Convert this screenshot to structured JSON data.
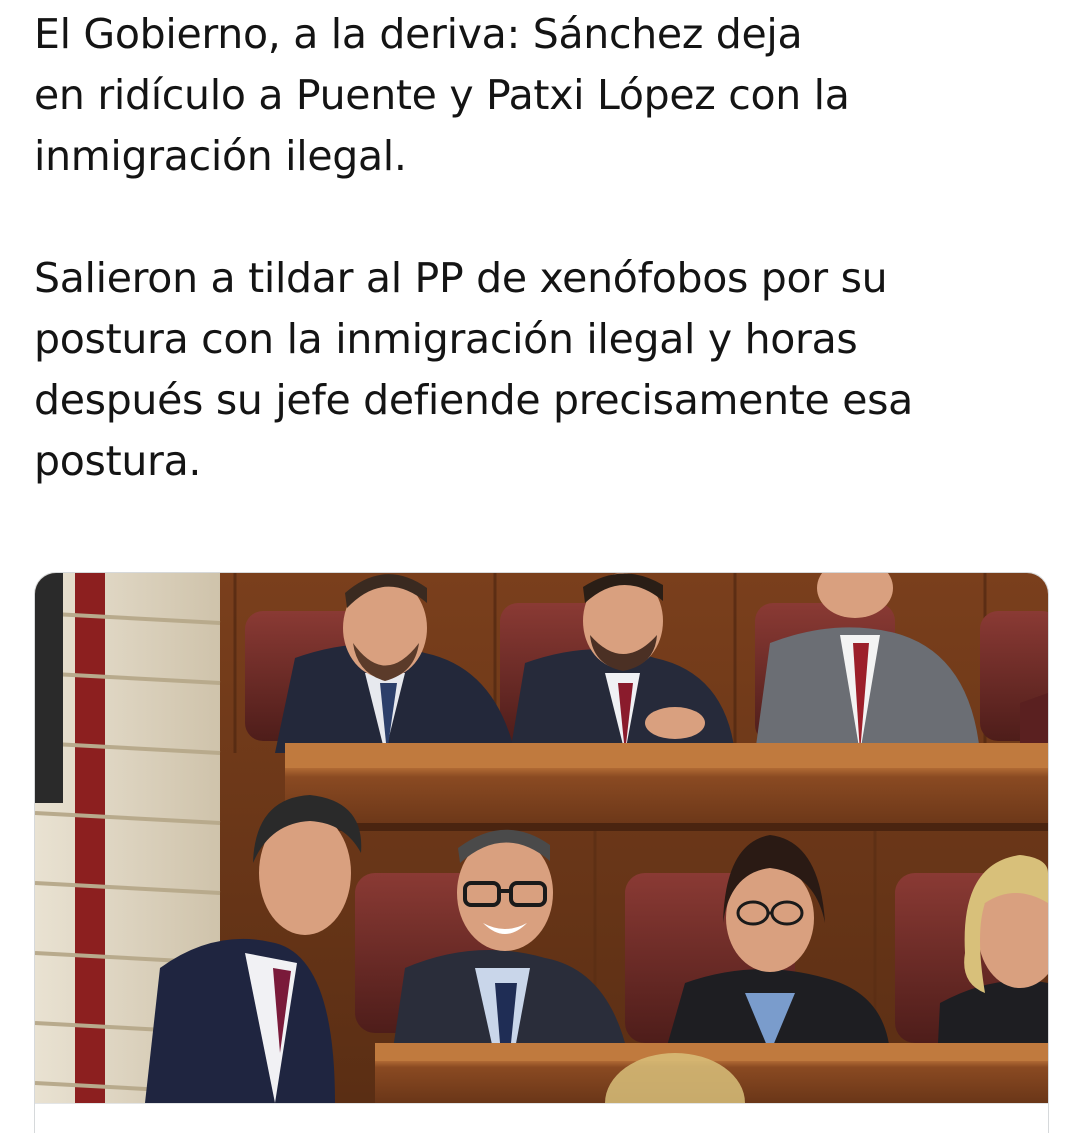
{
  "tweet": {
    "paragraph_1": "El Gobierno, a la deriva: Sánchez deja\nen ridículo a Puente y Patxi López con la\ninmigración ilegal.",
    "paragraph_2": "Salieron a tildar al PP de xenófobos por su\npostura con la inmigración ilegal y horas\ndespués su jefe defiende precisamente esa\npostura."
  },
  "media": {
    "description_icon": "photo-image",
    "colors": {
      "wood_dark": "#5a2e14",
      "wood_mid": "#8a4a22",
      "wood_light": "#b06a34",
      "seat_red": "#6e2a26",
      "suit_dark": "#23283a",
      "suit_grey": "#6b6e74",
      "tie_red": "#9c1f2a",
      "skin": "#d9a07f"
    }
  }
}
